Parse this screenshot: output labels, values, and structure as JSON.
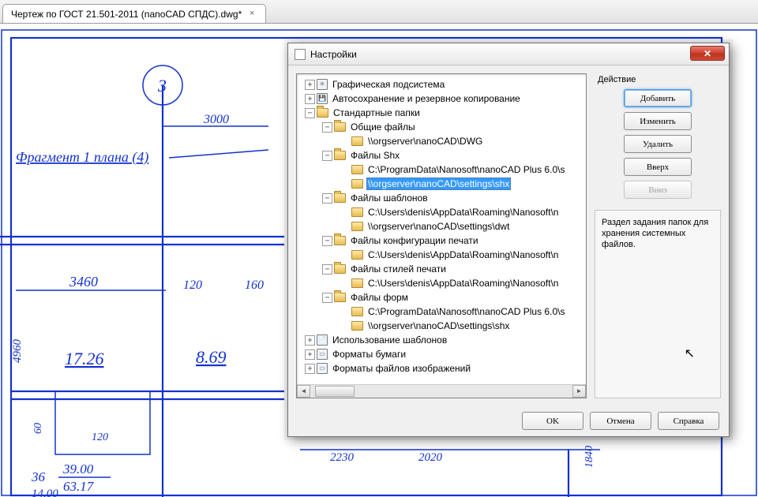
{
  "tab": {
    "title": "Чертеж по ГОСТ 21.501-2011 (nanoCAD СПДС).dwg*"
  },
  "drawing": {
    "bubble": "3",
    "dim_3000": "3000",
    "fragment_label": "Фрагмент 1 плана (4)",
    "dim_3460": "3460",
    "dim_120a": "120",
    "dim_160": "160",
    "dim_4960": "4960",
    "val_1726": "17.26",
    "val_869": "8.69",
    "dim_60": "60",
    "dim_120b": "120",
    "dim_2230": "2230",
    "dim_2020": "2020",
    "dim_1840": "1840",
    "dim_36": "36",
    "dim_1400": "14.00",
    "frac_top": "39.00",
    "frac_bot": "63.17"
  },
  "dialog": {
    "title": "Настройки",
    "tree": {
      "n_graphics": "Графическая подсистема",
      "n_autosave": "Автосохранение и резервное копирование",
      "n_stdfolders": "Стандартные папки",
      "n_common": "Общие файлы",
      "n_common_p1": "\\\\orgserver\\nanoCAD\\DWG",
      "n_shx": "Файлы Shx",
      "n_shx_p1": "C:\\ProgramData\\Nanosoft\\nanoCAD Plus 6.0\\s",
      "n_shx_p2": "\\\\orgserver\\nanoCAD\\settings\\shx",
      "n_templates": "Файлы шаблонов",
      "n_templates_p1": "C:\\Users\\denis\\AppData\\Roaming\\Nanosoft\\n",
      "n_templates_p2": "\\\\orgserver\\nanoCAD\\settings\\dwt",
      "n_printcfg": "Файлы конфигурации печати",
      "n_printcfg_p1": "C:\\Users\\denis\\AppData\\Roaming\\Nanosoft\\n",
      "n_printstyle": "Файлы стилей печати",
      "n_printstyle_p1": "C:\\Users\\denis\\AppData\\Roaming\\Nanosoft\\n",
      "n_forms": "Файлы форм",
      "n_forms_p1": "C:\\ProgramData\\Nanosoft\\nanoCAD Plus 6.0\\s",
      "n_forms_p2": "\\\\orgserver\\nanoCAD\\settings\\shx",
      "n_tmpluse": "Использование шаблонов",
      "n_paper": "Форматы бумаги",
      "n_imgfmt": "Форматы файлов изображений"
    },
    "actions": {
      "label": "Действие",
      "add": "Добавить",
      "edit": "Изменить",
      "delete": "Удалить",
      "up": "Вверх",
      "down": "Вниз"
    },
    "description": "Раздел задания папок для хранения системных файлов.",
    "buttons": {
      "ok": "OK",
      "cancel": "Отмена",
      "help": "Справка"
    }
  }
}
